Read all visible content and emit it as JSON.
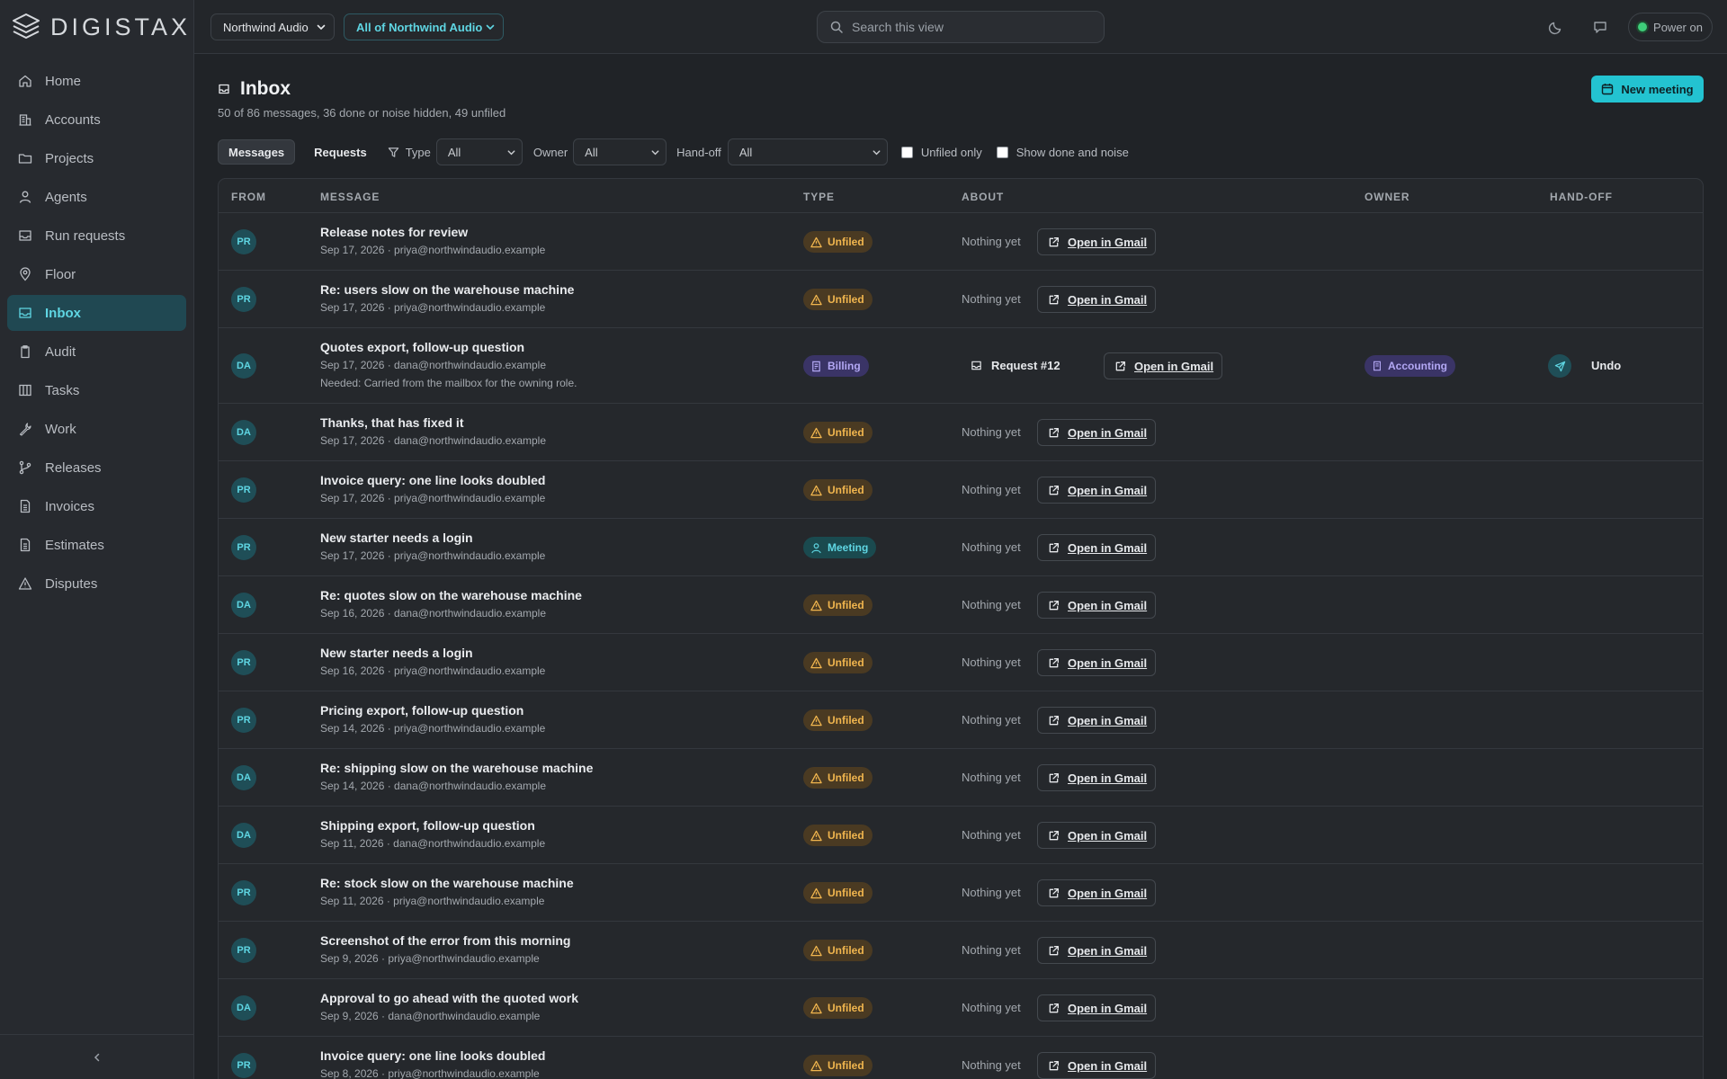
{
  "brand": {
    "name": "DIGISTAX"
  },
  "topbar": {
    "org_select": "Northwind Audio",
    "scope_select": "All of Northwind Audio",
    "search_placeholder": "Search this view",
    "power_label": "Power on"
  },
  "nav": [
    {
      "label": "Home",
      "icon": "home-icon"
    },
    {
      "label": "Accounts",
      "icon": "building-icon"
    },
    {
      "label": "Projects",
      "icon": "folder-icon"
    },
    {
      "label": "Agents",
      "icon": "person-icon"
    },
    {
      "label": "Run requests",
      "icon": "inbox-icon"
    },
    {
      "label": "Floor",
      "icon": "pin-icon"
    },
    {
      "label": "Inbox",
      "icon": "inbox-icon",
      "active": true
    },
    {
      "label": "Audit",
      "icon": "clipboard-icon"
    },
    {
      "label": "Tasks",
      "icon": "columns-icon"
    },
    {
      "label": "Work",
      "icon": "wrench-icon"
    },
    {
      "label": "Releases",
      "icon": "branch-icon"
    },
    {
      "label": "Invoices",
      "icon": "document-icon"
    },
    {
      "label": "Estimates",
      "icon": "document-icon"
    },
    {
      "label": "Disputes",
      "icon": "warning-icon"
    }
  ],
  "page": {
    "title": "Inbox",
    "subtitle": "50 of 86 messages, 36 done or noise hidden, 49 unfiled",
    "new_meeting": "New meeting"
  },
  "filters": {
    "tab_messages": "Messages",
    "tab_requests": "Requests",
    "type_label": "Type",
    "type_value": "All",
    "owner_label": "Owner",
    "owner_value": "All",
    "handoff_label": "Hand-off",
    "handoff_value": "All",
    "unfiled_only": "Unfiled only",
    "show_done": "Show done and noise"
  },
  "table": {
    "headers": {
      "from": "FROM",
      "message": "MESSAGE",
      "type": "TYPE",
      "about": "ABOUT",
      "owner": "OWNER",
      "handoff": "HAND-OFF"
    },
    "nothing_yet": "Nothing yet",
    "open_gmail": "Open in Gmail",
    "rows": [
      {
        "initials": "PR",
        "subject": "Release notes for review",
        "meta": "Sep 17, 2026 · priya@northwindaudio.example",
        "type": "Unfiled"
      },
      {
        "initials": "PR",
        "subject": "Re: users slow on the warehouse machine",
        "meta": "Sep 17, 2026 · priya@northwindaudio.example",
        "type": "Unfiled"
      },
      {
        "initials": "DA",
        "subject": "Quotes export, follow-up question",
        "meta": "Sep 17, 2026 · dana@northwindaudio.example",
        "note": "Needed: Carried from the mailbox for the owning role.",
        "type": "Billing",
        "request": "Request #12",
        "owner": "Accounting",
        "handoff": "Undo"
      },
      {
        "initials": "DA",
        "subject": "Thanks, that has fixed it",
        "meta": "Sep 17, 2026 · dana@northwindaudio.example",
        "type": "Unfiled"
      },
      {
        "initials": "PR",
        "subject": "Invoice query: one line looks doubled",
        "meta": "Sep 17, 2026 · priya@northwindaudio.example",
        "type": "Unfiled"
      },
      {
        "initials": "PR",
        "subject": "New starter needs a login",
        "meta": "Sep 17, 2026 · priya@northwindaudio.example",
        "type": "Meeting"
      },
      {
        "initials": "DA",
        "subject": "Re: quotes slow on the warehouse machine",
        "meta": "Sep 16, 2026 · dana@northwindaudio.example",
        "type": "Unfiled"
      },
      {
        "initials": "PR",
        "subject": "New starter needs a login",
        "meta": "Sep 16, 2026 · priya@northwindaudio.example",
        "type": "Unfiled"
      },
      {
        "initials": "PR",
        "subject": "Pricing export, follow-up question",
        "meta": "Sep 14, 2026 · priya@northwindaudio.example",
        "type": "Unfiled"
      },
      {
        "initials": "DA",
        "subject": "Re: shipping slow on the warehouse machine",
        "meta": "Sep 14, 2026 · dana@northwindaudio.example",
        "type": "Unfiled"
      },
      {
        "initials": "DA",
        "subject": "Shipping export, follow-up question",
        "meta": "Sep 11, 2026 · dana@northwindaudio.example",
        "type": "Unfiled"
      },
      {
        "initials": "PR",
        "subject": "Re: stock slow on the warehouse machine",
        "meta": "Sep 11, 2026 · priya@northwindaudio.example",
        "type": "Unfiled"
      },
      {
        "initials": "PR",
        "subject": "Screenshot of the error from this morning",
        "meta": "Sep 9, 2026 · priya@northwindaudio.example",
        "type": "Unfiled"
      },
      {
        "initials": "DA",
        "subject": "Approval to go ahead with the quoted work",
        "meta": "Sep 9, 2026 · dana@northwindaudio.example",
        "type": "Unfiled"
      },
      {
        "initials": "PR",
        "subject": "Invoice query: one line looks doubled",
        "meta": "Sep 8, 2026 · priya@northwindaudio.example",
        "type": "Unfiled"
      }
    ]
  },
  "colors": {
    "accent": "#23c3d1",
    "unfiled": "#f0b54e",
    "billing": "#b3a8f4",
    "sidebar_active": "#204852"
  }
}
